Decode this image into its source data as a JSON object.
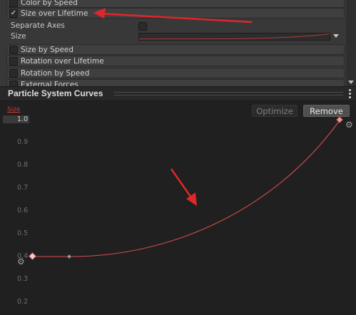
{
  "inspector": {
    "modules_top": [
      {
        "label": "Color by Speed",
        "checked": false
      },
      {
        "label": "Size over Lifetime",
        "checked": true
      }
    ],
    "properties": {
      "separate_axes_label": "Separate Axes",
      "size_label": "Size"
    },
    "modules_bottom": [
      {
        "label": "Size by Speed",
        "checked": false
      },
      {
        "label": "Rotation over Lifetime",
        "checked": false
      },
      {
        "label": "Rotation by Speed",
        "checked": false
      },
      {
        "label": "External Forces",
        "checked": false
      }
    ]
  },
  "curves_window": {
    "title": "Particle System Curves",
    "curve_tag": "Size",
    "optimize_label": "Optimize",
    "remove_label": "Remove",
    "y_ticks": [
      "1.0",
      "0.9",
      "0.8",
      "0.7",
      "0.6",
      "0.5",
      "0.4",
      "0.3",
      "0.2"
    ],
    "curve_color": "#d24b4b",
    "highlight_arrow_color": "#e0262b",
    "curve_keys": [
      {
        "time": 0.0,
        "value": 0.4
      },
      {
        "time": 1.0,
        "value": 1.0
      }
    ]
  },
  "icons": {
    "gear": "⚙",
    "check": "✓"
  }
}
